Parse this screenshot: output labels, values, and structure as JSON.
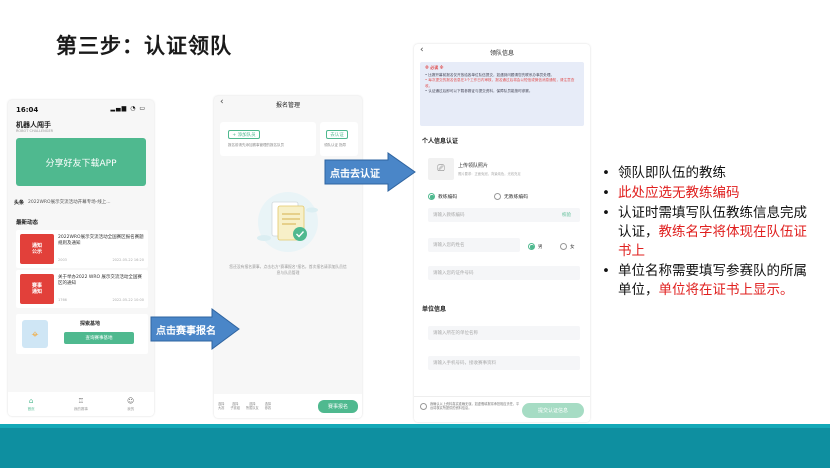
{
  "slide": {
    "title": "第三步：认证领队"
  },
  "phone1": {
    "time": "16:04",
    "signal": "▂▄▆ ◔ ▭",
    "brand": "机器人闯手",
    "brand_sub": "ROBOT CHALLENGER",
    "share_button": "分享好友下载APP",
    "news_tag": "头条",
    "news_text": "2022WRO展示交流活动开幕专场-线上...",
    "latest_heading": "最新动态",
    "cards": [
      {
        "thumb": "通知\n公示",
        "title": "2022WRO展示交流活动全国赛区报名赛题规则及通知",
        "date": "2022-05-22 16:20",
        "views": "2003"
      },
      {
        "thumb": "赛事\n通知",
        "title": "关于举办2022 WRO 展示交流活动全国赛区的通知",
        "date": "2022-05-22 10:00",
        "views": "1766"
      }
    ],
    "explore_title": "探索基地",
    "explore_button": "查询赛事基地",
    "tabs": [
      "首页",
      "我的赛事",
      "我的"
    ]
  },
  "phone2": {
    "header": "报名管理",
    "add_button": "+ 添加队员",
    "add_desc": "报名前请先添加赛事管理的报名队员",
    "cert_button": "去认证",
    "cert_desc": "领队认证 指导",
    "hint": "您还没有报名赛事，点击右方\"赛事报名\"报名，首次报名请添加队员信息与队员管理",
    "steps": [
      "选择\n大赛",
      "选择\n子赛组",
      "选择\n所属队友",
      "选择\n参赛"
    ],
    "cta": "赛事报名"
  },
  "phone3": {
    "header": "领队信息",
    "notice_head": "※ 必读 ※",
    "notice_lines": [
      "• 比赛开幕前报名仅开放给各单位队伍提交，如遇到问题请您先联系办事员处理。",
      "• 每次提交的报名信息在3个工作日内审核，报名通过后将会以短信或微信消息通知，请注意查收。",
      "• 认证通过后即可以下载参赛证与提交资料，保障队员能按时参赛。"
    ],
    "personal_heading": "个人信息认证",
    "upload_title": "上传领队照片",
    "upload_desc": "照片要求：正面免冠，背景纯色，光线充足",
    "radio_code": "教练编码",
    "radio_nocode": "无教练编码",
    "code_placeholder": "请输入教练编码",
    "verify_label": "校验",
    "name_placeholder": "请输入您的姓名",
    "male": "男",
    "female": "女",
    "id_placeholder": "请输入您的证件号码",
    "unit_heading": "单位信息",
    "unit_placeholder": "请输入所在的单位名称",
    "phone_placeholder": "请输入手机号码，接收赛事资料",
    "foot_text": "我确认以上资料真实准确无误，如虚假填报将承担相应责任，平台将核实所提供的资料信息。",
    "submit": "提交认证信息"
  },
  "callouts": {
    "signup": "点击赛事报名",
    "certify": "点击去认证"
  },
  "notes": {
    "n1": "领队即队伍的教练",
    "n2": "此处应选无教练编码",
    "n3_black": "认证时需填写队伍教练信息完成认证，",
    "n3_red": "教练名字将体现在队伍证书上",
    "n4_black": "单位名称需要填写参赛队的所属单位，",
    "n4_red": "单位将在证书上显示。"
  },
  "colors": {
    "accent": "#4fb98f",
    "highlight": "#e0201f",
    "arrow": "#4a86c8",
    "band": "#0e8fa0"
  }
}
